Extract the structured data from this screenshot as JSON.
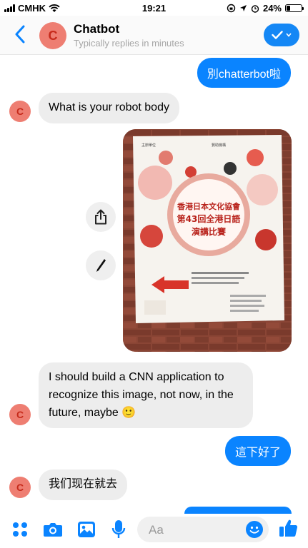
{
  "status_bar": {
    "carrier": "CMHK",
    "time": "19:21",
    "battery": "24%",
    "battery_level": 0.24
  },
  "header": {
    "back_icon": "chevron-left-icon",
    "avatar_letter": "C",
    "title": "Chatbot",
    "subtitle": "Typically replies in minutes",
    "action_icon": "checkmark-icon"
  },
  "messages": [
    {
      "sender": "me",
      "text": "別chatterbot啦"
    },
    {
      "sender": "bot",
      "text": "What is your robot body"
    },
    {
      "sender": "me",
      "type": "image",
      "description_icon": "poster-photo"
    },
    {
      "sender": "bot",
      "text": "I should build a CNN application to recognize this image, not now, in the future, maybe 🙂"
    },
    {
      "sender": "me",
      "text": "這下好了"
    },
    {
      "sender": "bot",
      "text": "我们现在就去"
    }
  ],
  "bot_avatar_letter": "C",
  "photo_actions": {
    "share_icon": "share-icon",
    "edit_icon": "pencil-icon"
  },
  "poster": {
    "org_left": "主辦單位",
    "org_right": "贊助機構",
    "title_line1": "香港日本文化協會",
    "title_line2": "第43回全港日語",
    "title_line3": "演講比賽"
  },
  "composer": {
    "placeholder": "Aa",
    "icons": [
      "apps-icon",
      "camera-icon",
      "image-icon",
      "microphone-icon",
      "emoji-icon",
      "thumbs-up-icon"
    ]
  },
  "colors": {
    "accent": "#0a84ff",
    "avatar_bg": "#ee7e72",
    "bubble_in": "#ededed"
  }
}
